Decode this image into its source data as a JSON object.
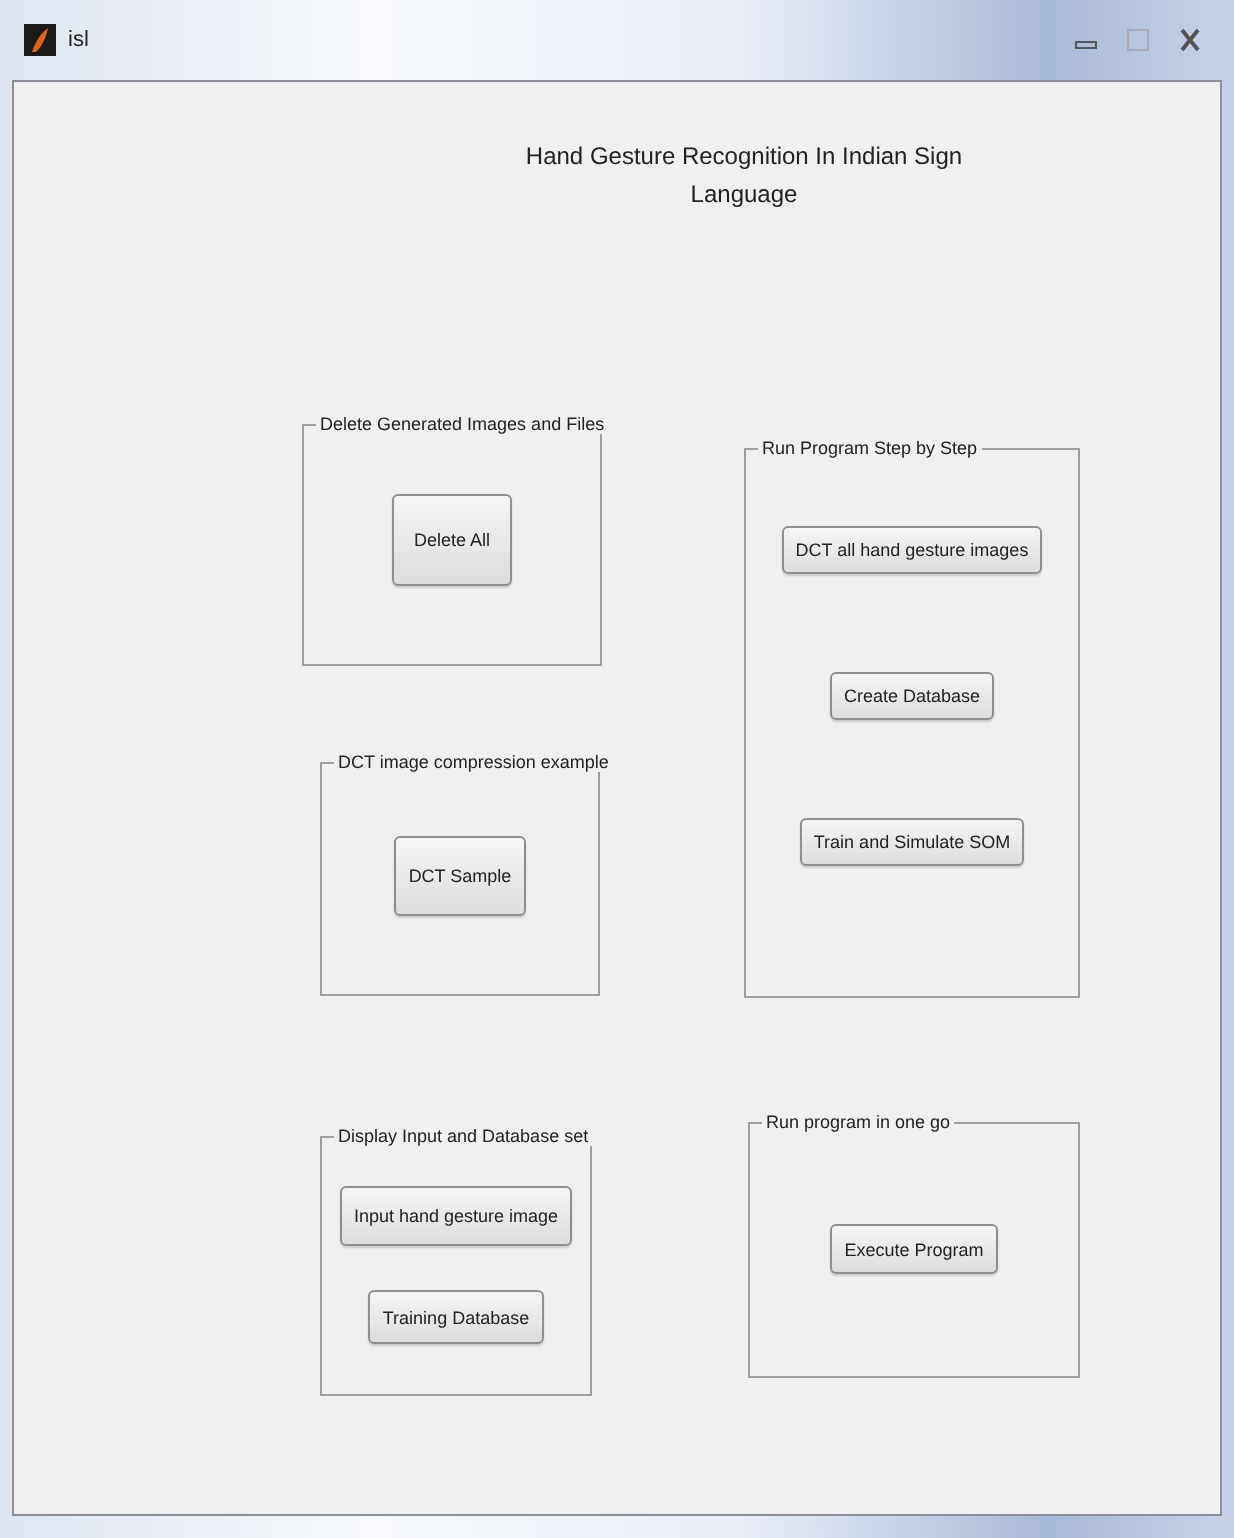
{
  "window": {
    "title": "isl"
  },
  "heading": [
    "Hand Gesture Recognition In Indian Sign",
    "Language"
  ],
  "left_panels": [
    {
      "title": "Delete Generated Images and Files",
      "buttons": [
        "Delete All"
      ]
    },
    {
      "title": "DCT image compression example",
      "buttons": [
        "DCT Sample"
      ]
    },
    {
      "title": "Display Input and Database set",
      "buttons": [
        "Input hand gesture image",
        "Training Database"
      ]
    }
  ],
  "right_panels": [
    {
      "title": "Run Program Step by Step",
      "buttons": [
        "DCT all hand gesture images",
        "Create Database",
        "Train and Simulate SOM"
      ]
    },
    {
      "title": "Run program in one go",
      "buttons": [
        "Execute Program"
      ]
    }
  ]
}
